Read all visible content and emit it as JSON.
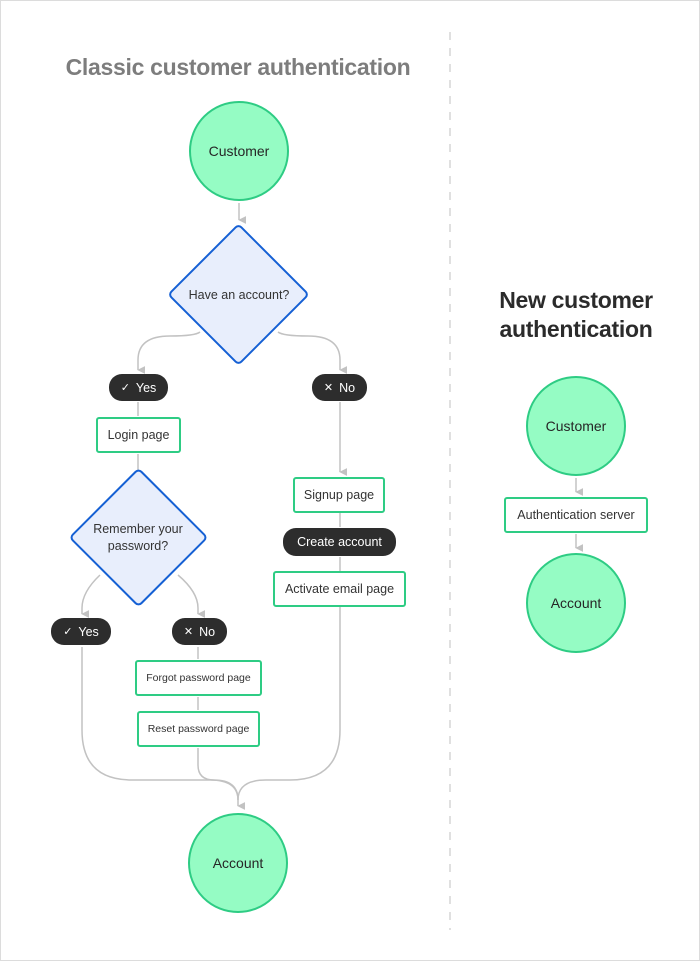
{
  "colors": {
    "node_fill": "#95fcc4",
    "node_border": "#2ecc84",
    "decision_fill": "#e8eefc",
    "decision_border": "#1560d4",
    "pill_fill": "#2d2d2d",
    "connector": "#c2c2c2"
  },
  "classic": {
    "title": "Classic customer authentication",
    "start_node": "Customer",
    "decision_account": "Have an account?",
    "yes_label": "Yes",
    "no_label": "No",
    "login_page": "Login page",
    "decision_password_line1": "Remember your",
    "decision_password_line2": "password?",
    "pw_yes_label": "Yes",
    "pw_no_label": "No",
    "forgot_password_page": "Forgot password page",
    "reset_password_page": "Reset password page",
    "signup_page": "Signup page",
    "create_account": "Create account",
    "activate_email_page": "Activate email page",
    "end_node": "Account"
  },
  "new": {
    "title": "New customer authentication",
    "start_node": "Customer",
    "server": "Authentication server",
    "end_node": "Account"
  },
  "icons": {
    "check": "✓",
    "cross": "✕"
  }
}
